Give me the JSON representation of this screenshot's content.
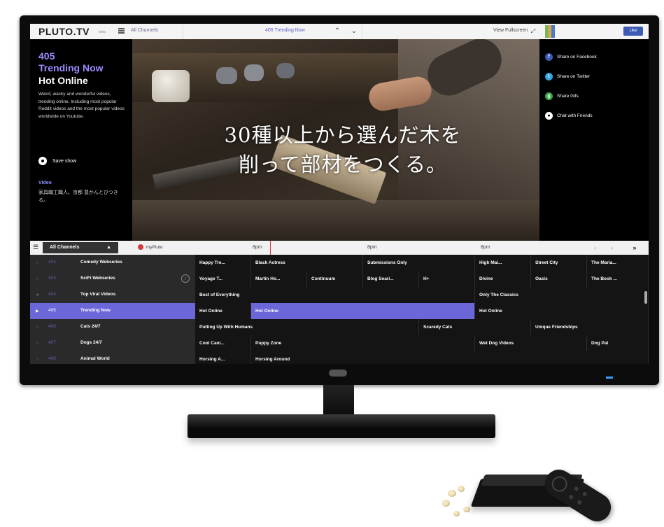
{
  "topbar": {
    "logo": "PLUTO.TV",
    "logo_suffix": "beta",
    "all_channels": "All Channels",
    "now_title": "405 Trending Now",
    "view_fullscreen": "View Fullscreen",
    "like_label": "Like"
  },
  "now_playing": {
    "channel_number": "405",
    "channel_name": "Trending Now",
    "show_title": "Hot Online",
    "description": "Weird, wacky and wonderful videos, trending online. Including most popular Reddit videos and the most popular videos worldwide on Youtube.",
    "save_show": "Save show",
    "video_label": "Video",
    "video_caption": "家具職工職人、京都 豊かんとびつきる。"
  },
  "video": {
    "subtitle_line1": "30種以上から選んだ木を",
    "subtitle_line2": "削って部材をつくる。"
  },
  "share": [
    {
      "label": "Share on Facebook",
      "icon": "facebook-icon",
      "glyph": "f",
      "color": "#3b5bb5"
    },
    {
      "label": "Share on Twitter",
      "icon": "twitter-icon",
      "glyph": "t",
      "color": "#2fa6e0"
    },
    {
      "label": "Share Gifs",
      "icon": "gif-icon",
      "glyph": "g",
      "color": "#3daa4a"
    },
    {
      "label": "Chat with Friends",
      "icon": "chat-icon",
      "glyph": "•",
      "color": "#ffffff"
    }
  ],
  "guide": {
    "all_channels": "All Channels",
    "mypluto": "myPluto",
    "times": [
      "8pm",
      "8pm",
      "8pm"
    ],
    "nav_next": "»"
  },
  "rows": [
    {
      "num": "402",
      "name": "Comedy Webseries",
      "active": false,
      "programs": [
        "Happy Tre...",
        "Black Actress",
        "Submissions Only",
        "High Mai...",
        "Street City",
        "The Maria..."
      ]
    },
    {
      "num": "403",
      "name": "SciFi Webseries",
      "active": false,
      "programs": [
        "Voyage T...",
        "Martin Ho...",
        "Continuum",
        "Blog Seari...",
        "H+",
        "Divine",
        "Oasis",
        "The Book ..."
      ]
    },
    {
      "num": "404",
      "name": "Top Viral Videos",
      "active": false,
      "programs": [
        "Best of Everything",
        "Only The Classics"
      ]
    },
    {
      "num": "405",
      "name": "Trending Now",
      "active": true,
      "programs": [
        "Hot Online",
        "Hot Online",
        "Hot Online"
      ]
    },
    {
      "num": "406",
      "name": "Cats 24/7",
      "active": false,
      "programs": [
        "Putting Up With Humans",
        "Scaredy Cats",
        "Unique Friendships"
      ]
    },
    {
      "num": "407",
      "name": "Dogs 24/7",
      "active": false,
      "programs": [
        "Cool Cani...",
        "Puppy Zone",
        "Wet Dog Videos",
        "Dog Pal"
      ]
    },
    {
      "num": "408",
      "name": "Animal World",
      "active": false,
      "programs": [
        "Horsing A...",
        "Horsing Around"
      ]
    }
  ]
}
